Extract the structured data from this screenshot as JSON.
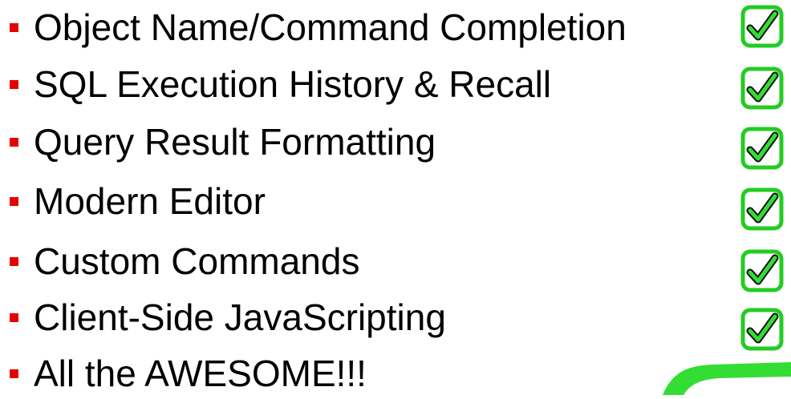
{
  "slide": {
    "items": [
      {
        "text": "Object Name/Command Completion",
        "checked": true
      },
      {
        "text": "SQL Execution History & Recall",
        "checked": true
      },
      {
        "text": "Query Result Formatting",
        "checked": true
      },
      {
        "text": "Modern Editor",
        "checked": true
      },
      {
        "text": "Custom Commands",
        "checked": true
      },
      {
        "text": "Client-Side JavaScripting",
        "checked": true
      },
      {
        "text": "All the AWESOME!!!",
        "checked": false
      }
    ],
    "colors": {
      "bullet": "#e60000",
      "text": "#000000",
      "check_stroke": "#22cc22",
      "check_fill": "#33dd33"
    },
    "icons": {
      "checkbox": "green-checkbox-icon",
      "bullet": "red-square-bullet-icon",
      "swoosh": "green-swoosh-decoration"
    }
  }
}
